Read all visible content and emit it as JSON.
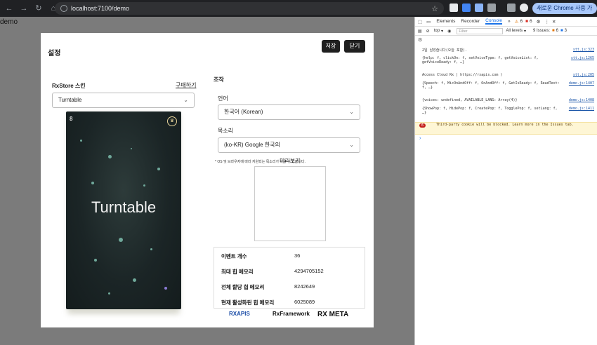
{
  "browser": {
    "url": "localhost:7100/demo",
    "update_button": "새로운 Chrome 사용 가능"
  },
  "page": {
    "label": "demo"
  },
  "modal": {
    "title": "설정",
    "save_label": "저장",
    "close_label": "닫기",
    "skin_label": "RxStore 스킨",
    "buy_link": "구매하기",
    "skin_value": "Turntable",
    "card": {
      "number": "8",
      "name": "Turntable"
    },
    "control_title": "조작",
    "language_label": "언어",
    "language_value": "한국어 (Korean)",
    "voice_label": "목소리",
    "voice_value": "(ko-KR) Google 한국의",
    "voice_note": "* OS 및 브라우저에 따라 지원되는 목소리가 다를 수 있습니다.",
    "preview_label": "미리보기",
    "stats": [
      {
        "key": "이벤트 개수",
        "value": "36"
      },
      {
        "key": "최대 힙 메모리",
        "value": "4294705152"
      },
      {
        "key": "전체 할당 힙 메모리",
        "value": "8242649"
      },
      {
        "key": "현재 활성화된 힙 메모리",
        "value": "6025089"
      }
    ],
    "logos": [
      "RXAPIS",
      "RxFramework",
      "RX META"
    ]
  },
  "devtools": {
    "tabs": [
      "Elements",
      "Recorder",
      "Console"
    ],
    "active_tab": "Console",
    "warn_count": "6",
    "error_count": "6",
    "context": "top",
    "filter_placeholder": "Filter",
    "levels": "All levels",
    "issues": "9 Issues:",
    "issues_a": "6",
    "issues_b": "3",
    "logs": [
      {
        "text": "2일 남았습니다(오늘 포함).",
        "src": "stt.js:323"
      },
      {
        "text": "{help: f, clickOn: f, setVoiceType: f, getVoiceList: f, getVoiceReady: f, …}",
        "src": "stt.js:1265"
      },
      {
        "text": "Access Cloud Rx | https://rxapis.com )",
        "src": "stt.js:205"
      },
      {
        "text": "{Speech: f, MicOnAndOff: f, OnAndOff: f, GetIsReady: f, ReadText: f, …}",
        "src": "demo.js:1407"
      },
      {
        "text": "{voices: undefined, AVAILABLE_LANG: Array(4)}",
        "src": "demo.js:1408"
      },
      {
        "text": "{ShowPop: f, HidePop: f, CreatePop: f, TogglePop: f, setLang: f, …}",
        "src": "demo.js:1411"
      },
      {
        "text": "Third-party cookie will be blocked. Learn more in the Issues tab.",
        "src": "",
        "badge": "6"
      }
    ]
  }
}
